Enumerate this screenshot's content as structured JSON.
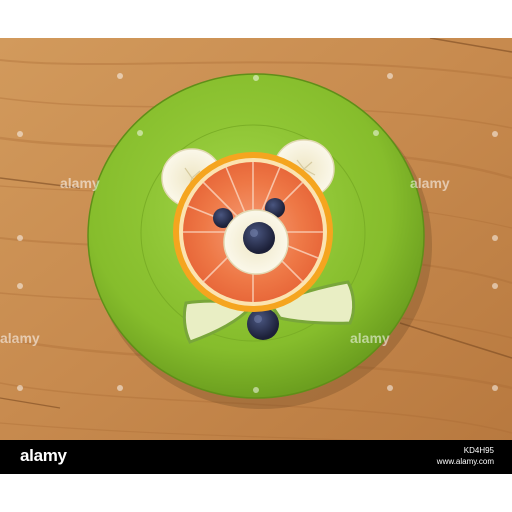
{
  "watermark": {
    "text": "alamy"
  },
  "footer": {
    "brand": "alamy",
    "image_code": "KD4H95",
    "site": "www.alamy.com"
  },
  "colors": {
    "plate": "#8cc232",
    "plate_rim": "#6ea31e",
    "orange_peel": "#f4a321",
    "grapefruit_flesh": "#f07a4a",
    "banana": "#f6f1dc",
    "blueberry": "#2c3050",
    "pear_skin": "#7aa83a",
    "pear_flesh": "#ecf0c8",
    "wood": "#c98d51",
    "footer_bg": "#000000"
  },
  "subject": {
    "ears": "banana-slice",
    "face": "grapefruit-slice",
    "eyes": "blueberry",
    "snout": "banana-slice",
    "nose": "blueberry",
    "bow_tie": "pear-slices",
    "bow_knot": "blueberry"
  }
}
